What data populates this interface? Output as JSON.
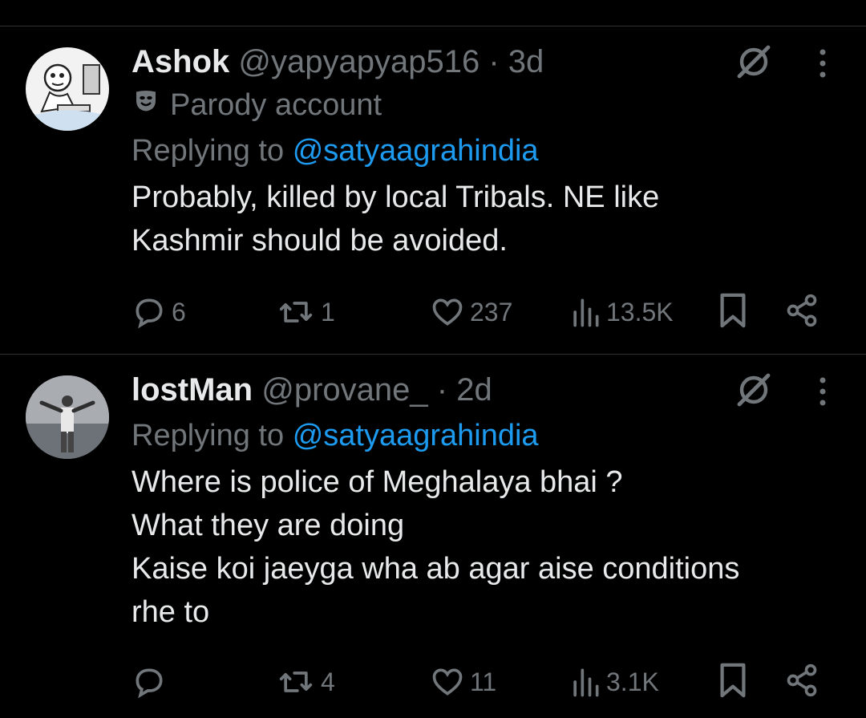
{
  "tweets": [
    {
      "name": "Ashok",
      "handle": "@yapyapyap516",
      "separator": "·",
      "time": "3d",
      "badge_icon": "parody-mask-icon",
      "badge_text": "Parody account",
      "replying_prefix": "Replying to",
      "replying_to": "@satyaagrahindia",
      "text": "Probably, killed by local Tribals. NE like\nKashmir should be avoided.",
      "actions": {
        "replies": "6",
        "reposts": "1",
        "likes": "237",
        "views": "13.5K"
      }
    },
    {
      "name": "lostMan",
      "handle": "@provane_",
      "separator": "·",
      "time": "2d",
      "replying_prefix": "Replying to",
      "replying_to": "@satyaagrahindia",
      "text": "Where is police of Meghalaya bhai ?\nWhat they are doing\nKaise koi jaeyga wha ab agar aise conditions\nrhe to",
      "actions": {
        "replies": "",
        "reposts": "4",
        "likes": "11",
        "views": "3.1K"
      }
    }
  ],
  "colors": {
    "background": "#000000",
    "text": "#e7e9ea",
    "muted": "#71767b",
    "link": "#1d9bf0",
    "divider": "#2f3336"
  },
  "icons": [
    "grok-icon",
    "more-icon",
    "reply-icon",
    "repost-icon",
    "like-icon",
    "views-icon",
    "bookmark-icon",
    "share-icon"
  ]
}
